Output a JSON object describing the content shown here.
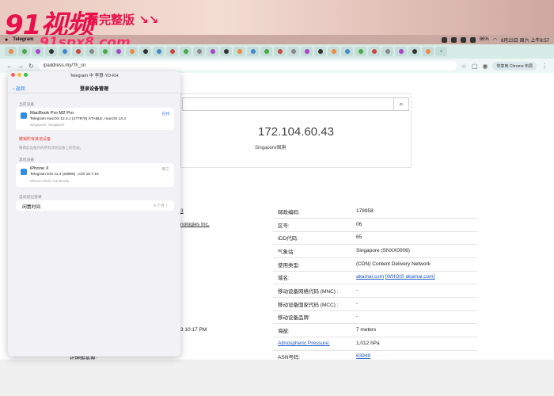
{
  "watermark": {
    "logo": "91视频",
    "tagline": "看完整版 ↘↘",
    "url": "91spx8.com"
  },
  "menubar": {
    "app_name": "Telegram",
    "battery": "86%",
    "datetime": "6月23日 周六 上午8:57"
  },
  "browser": {
    "url": "ipaddress.my/?h_cn",
    "chrome_button": "恢复到 Chrome 布局"
  },
  "ip_page": {
    "ip": "172.104.60.43",
    "flag_alt": "Singapore国旗",
    "left_fragments": [
      {
        "id": "f1",
        "text": "3"
      },
      {
        "id": "f2",
        "text": "nologies Inc."
      },
      {
        "id": "f3",
        "text": "3 10:17 PM"
      },
      {
        "id": "f4",
        "text": "代理服务器:"
      }
    ],
    "rows": [
      {
        "key": "邮政编码:",
        "value": "178958"
      },
      {
        "key": "区号:",
        "value": "06"
      },
      {
        "key": "IDD代码:",
        "value": "65"
      },
      {
        "key": "气象站:",
        "value": "Singapore (SNXX0006)"
      },
      {
        "key": "使用类型:",
        "value": "(CDN) Content Delivery Network"
      },
      {
        "key": "域名:",
        "value": "akamai.com",
        "value2": "[WHOIS akamai.com]"
      },
      {
        "key": "移动设备网络代码 (MNC) :",
        "value": "-"
      },
      {
        "key": "移动设备国家代码 (MCC) :",
        "value": "-"
      },
      {
        "key": "移动设备品牌:",
        "value": "-"
      },
      {
        "key": "海拔:",
        "value": "7 meters"
      },
      {
        "key": "Atmospheric Pressure:",
        "value": "1,012 hPa"
      },
      {
        "key": "ASN号码:",
        "value": "63949"
      }
    ]
  },
  "telegram_panel": {
    "window_title": "Telegram 中 李慧-YD-KH",
    "back": "返回",
    "title": "登录设备管理",
    "current_section": "当前设备",
    "current_device": {
      "name": "MacBook Pro M2 Pro",
      "app": "Telegram macOS 12.4.1 (277879) STABLE, macOS 13.4",
      "location": "Singapore, Singapore",
      "status": "在线"
    },
    "terminate_all": "撤销所有其他设备",
    "terminate_hint": "撤销此设备外的所有其他设备上的登录。",
    "other_section": "其他设备",
    "other_device": {
      "name": "iPhone X",
      "app": "Telegram iOS 11.4 (29896) , iOS 16.7.10",
      "location": "Phnom Penh, Cambodia",
      "time": "周三"
    },
    "auto_section": "自动退出登录",
    "idle_label": "闲置时间",
    "idle_value": "6 个月 〉"
  }
}
